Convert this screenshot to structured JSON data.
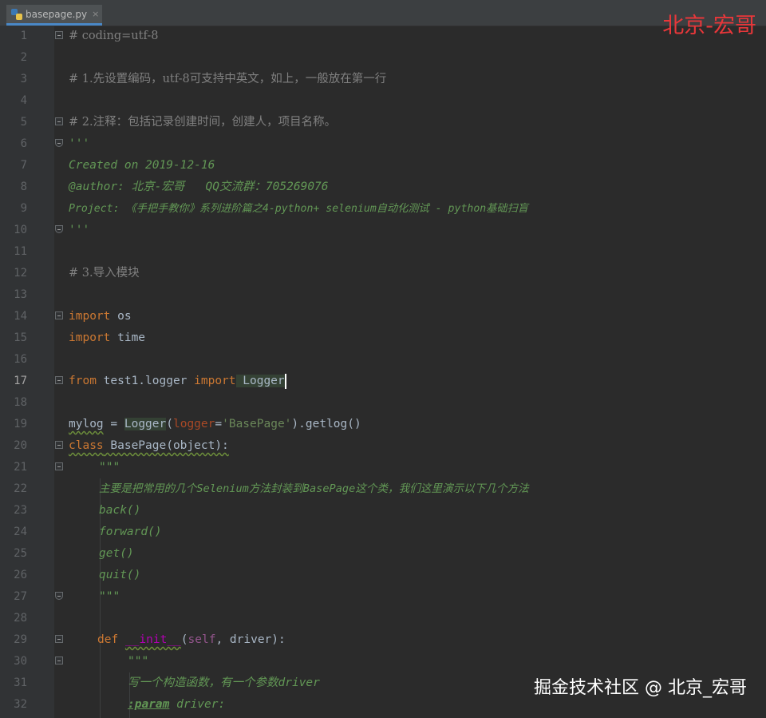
{
  "tab": {
    "filename": "basepage.py",
    "close_glyph": "×"
  },
  "watermarks": {
    "top": "北京-宏哥",
    "bottom": "掘金技术社区 @ 北京_宏哥"
  },
  "current_line": 17,
  "colors": {
    "keyword": "#cc7832",
    "comment": "#808080",
    "docstring": "#629755",
    "string": "#6a8759",
    "watermark_red": "#e8373a"
  },
  "lines": [
    {
      "n": "1",
      "t": "# coding=utf-8"
    },
    {
      "n": "2",
      "t": ""
    },
    {
      "n": "3",
      "t": "# 1.先设置编码，utf-8可支持中英文，如上，一般放在第一行"
    },
    {
      "n": "4",
      "t": ""
    },
    {
      "n": "5",
      "t": "# 2.注释：包括记录创建时间，创建人，项目名称。"
    },
    {
      "n": "6",
      "t": "'''"
    },
    {
      "n": "7",
      "t": "Created on 2019-12-16"
    },
    {
      "n": "8",
      "t": "@author: 北京-宏哥   QQ交流群：705269076"
    },
    {
      "n": "9",
      "t": "Project: 《手把手教你》系列进阶篇之4-python+ selenium自动化测试 - python基础扫盲"
    },
    {
      "n": "10",
      "t": "'''"
    },
    {
      "n": "11",
      "t": ""
    },
    {
      "n": "12",
      "t": "# 3.导入模块"
    },
    {
      "n": "13",
      "t": ""
    },
    {
      "n": "14",
      "kw": "import",
      "rest": " os"
    },
    {
      "n": "15",
      "kw": "import",
      "rest": " time"
    },
    {
      "n": "16",
      "t": ""
    },
    {
      "n": "17",
      "kw": "from",
      "mod": " test1.logger ",
      "kw2": "import",
      "rest": " Logger"
    },
    {
      "n": "18",
      "t": ""
    },
    {
      "n": "19",
      "a": "mylog",
      "b": " = ",
      "c": "Logger",
      "d": "(",
      "e": "logger",
      "f": "=",
      "g": "'BasePage'",
      "h": ").getlog()"
    },
    {
      "n": "20",
      "kw": "class",
      "rest": " BasePage(object):"
    },
    {
      "n": "21",
      "t": "\"\"\""
    },
    {
      "n": "22",
      "t": "主要是把常用的几个Selenium方法封装到BasePage这个类，我们这里演示以下几个方法"
    },
    {
      "n": "23",
      "t": "back()"
    },
    {
      "n": "24",
      "t": "forward()"
    },
    {
      "n": "25",
      "t": "get()"
    },
    {
      "n": "26",
      "t": "quit()"
    },
    {
      "n": "27",
      "t": "\"\"\""
    },
    {
      "n": "28",
      "t": ""
    },
    {
      "n": "29",
      "kw": "def",
      "sp": " ",
      "magic": "__init__",
      "p1": "(",
      "self": "self",
      "p2": ", driver):"
    },
    {
      "n": "30",
      "t": "\"\"\""
    },
    {
      "n": "31",
      "t": "写一个构造函数，有一个参数driver"
    },
    {
      "n": "32",
      "tag": ":param",
      "rest": " driver:"
    }
  ]
}
